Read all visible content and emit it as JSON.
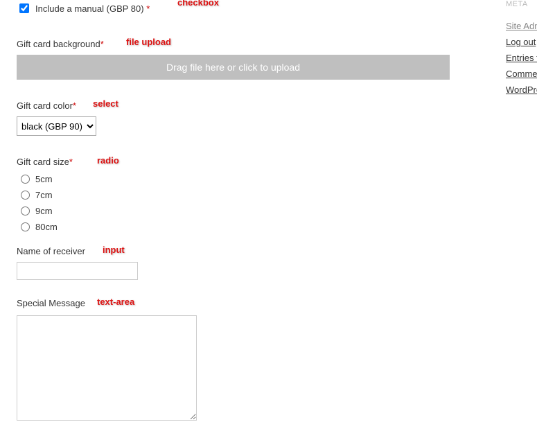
{
  "fields": {
    "manual": {
      "label": "Include a manual (GBP 80)",
      "required": true,
      "checked": true,
      "annot": "checkbox"
    },
    "background": {
      "label": "Gift card background",
      "required": true,
      "uploadText": "Drag file here or click to upload",
      "annot": "file upload"
    },
    "color": {
      "label": "Gift card color",
      "required": true,
      "selected": "black (GBP 90)",
      "annot": "select"
    },
    "size": {
      "label": "Gift card size",
      "required": true,
      "options": [
        "5cm",
        "7cm",
        "9cm",
        "80cm"
      ],
      "annot": "radio"
    },
    "receiver": {
      "label": "Name of receiver",
      "value": "",
      "annot": "input"
    },
    "message": {
      "label": "Special Message",
      "value": "",
      "annot": "text-area"
    }
  },
  "asterisk": "*",
  "sidebar": {
    "heading": "META",
    "links": [
      "Site Admin",
      "Log out",
      "Entries feed",
      "Comments feed",
      "WordPress.org"
    ]
  }
}
